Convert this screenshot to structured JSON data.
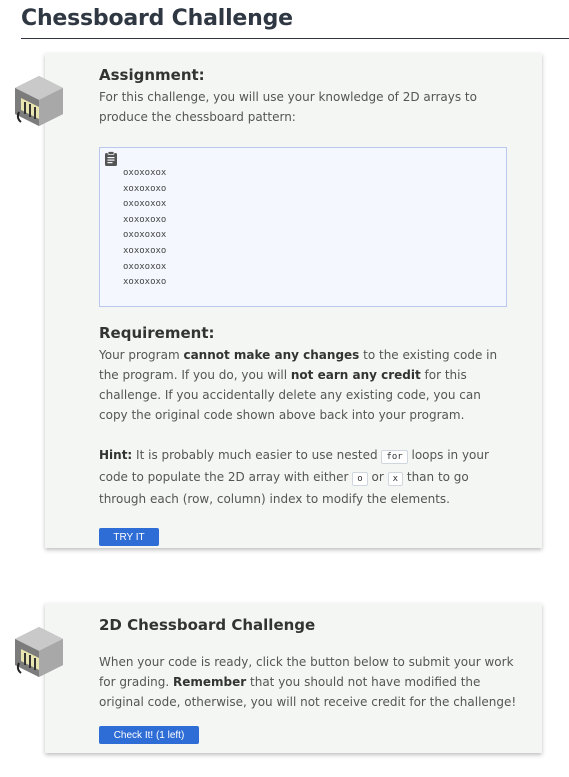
{
  "page": {
    "title": "Chessboard Challenge"
  },
  "assignment": {
    "heading": "Assignment:",
    "text": "For this challenge, you will use your knowledge of 2D arrays to produce the chessboard pattern:",
    "pattern": [
      "oxoxoxox",
      "xoxoxoxo",
      "oxoxoxox",
      "xoxoxoxo",
      "oxoxoxox",
      "xoxoxoxo",
      "oxoxoxox",
      "xoxoxoxo"
    ]
  },
  "requirement": {
    "heading": "Requirement:",
    "t1": "Your program ",
    "b1": "cannot make any changes",
    "t2": " to the existing code in the program. If you do, you will ",
    "b2": "not earn any credit",
    "t3": " for this challenge. If you accidentally delete any existing code, you can copy the original code shown above back into your program."
  },
  "hint": {
    "label": "Hint:",
    "t1": " It is probably much easier to use nested ",
    "code_for": "for",
    "t2": " loops in your code to populate the 2D array with either ",
    "code_o": "o",
    "t3": " or ",
    "code_x": "x",
    "t4": " than to go through each (row, column) index to modify the elements."
  },
  "try_button": "TRY IT",
  "submit": {
    "heading": "2D Chessboard Challenge",
    "t1": "When your code is ready, click the button below to submit your work for grading. ",
    "b1": "Remember",
    "t2": " that you should not have modified the original code, otherwise, you will not receive credit for the challenge!",
    "button": "Check It! (1 left)"
  },
  "icons": {
    "badge": "coding-exercise-icon",
    "clipboard": "clipboard-icon"
  },
  "colors": {
    "button": "#2f6dd6",
    "card": "#f3f6f2",
    "code_bg": "#f4f7fd",
    "code_border": "#b9c8ec"
  }
}
